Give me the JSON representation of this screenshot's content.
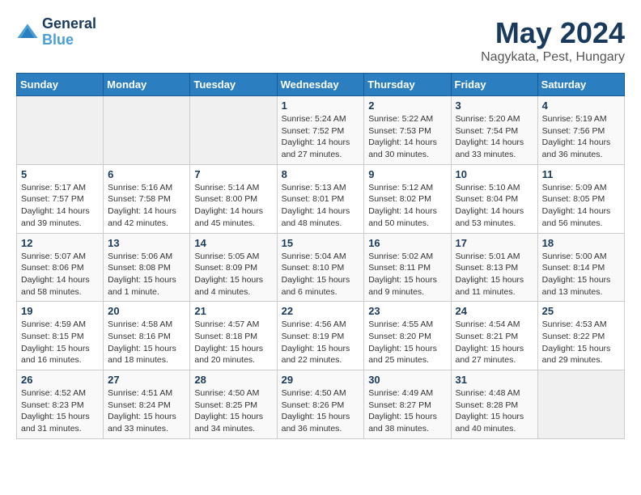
{
  "header": {
    "logo_line1": "General",
    "logo_line2": "Blue",
    "main_title": "May 2024",
    "subtitle": "Nagykata, Pest, Hungary"
  },
  "calendar": {
    "days_of_week": [
      "Sunday",
      "Monday",
      "Tuesday",
      "Wednesday",
      "Thursday",
      "Friday",
      "Saturday"
    ],
    "weeks": [
      [
        {
          "day": "",
          "info": ""
        },
        {
          "day": "",
          "info": ""
        },
        {
          "day": "",
          "info": ""
        },
        {
          "day": "1",
          "info": "Sunrise: 5:24 AM\nSunset: 7:52 PM\nDaylight: 14 hours\nand 27 minutes."
        },
        {
          "day": "2",
          "info": "Sunrise: 5:22 AM\nSunset: 7:53 PM\nDaylight: 14 hours\nand 30 minutes."
        },
        {
          "day": "3",
          "info": "Sunrise: 5:20 AM\nSunset: 7:54 PM\nDaylight: 14 hours\nand 33 minutes."
        },
        {
          "day": "4",
          "info": "Sunrise: 5:19 AM\nSunset: 7:56 PM\nDaylight: 14 hours\nand 36 minutes."
        }
      ],
      [
        {
          "day": "5",
          "info": "Sunrise: 5:17 AM\nSunset: 7:57 PM\nDaylight: 14 hours\nand 39 minutes."
        },
        {
          "day": "6",
          "info": "Sunrise: 5:16 AM\nSunset: 7:58 PM\nDaylight: 14 hours\nand 42 minutes."
        },
        {
          "day": "7",
          "info": "Sunrise: 5:14 AM\nSunset: 8:00 PM\nDaylight: 14 hours\nand 45 minutes."
        },
        {
          "day": "8",
          "info": "Sunrise: 5:13 AM\nSunset: 8:01 PM\nDaylight: 14 hours\nand 48 minutes."
        },
        {
          "day": "9",
          "info": "Sunrise: 5:12 AM\nSunset: 8:02 PM\nDaylight: 14 hours\nand 50 minutes."
        },
        {
          "day": "10",
          "info": "Sunrise: 5:10 AM\nSunset: 8:04 PM\nDaylight: 14 hours\nand 53 minutes."
        },
        {
          "day": "11",
          "info": "Sunrise: 5:09 AM\nSunset: 8:05 PM\nDaylight: 14 hours\nand 56 minutes."
        }
      ],
      [
        {
          "day": "12",
          "info": "Sunrise: 5:07 AM\nSunset: 8:06 PM\nDaylight: 14 hours\nand 58 minutes."
        },
        {
          "day": "13",
          "info": "Sunrise: 5:06 AM\nSunset: 8:08 PM\nDaylight: 15 hours\nand 1 minute."
        },
        {
          "day": "14",
          "info": "Sunrise: 5:05 AM\nSunset: 8:09 PM\nDaylight: 15 hours\nand 4 minutes."
        },
        {
          "day": "15",
          "info": "Sunrise: 5:04 AM\nSunset: 8:10 PM\nDaylight: 15 hours\nand 6 minutes."
        },
        {
          "day": "16",
          "info": "Sunrise: 5:02 AM\nSunset: 8:11 PM\nDaylight: 15 hours\nand 9 minutes."
        },
        {
          "day": "17",
          "info": "Sunrise: 5:01 AM\nSunset: 8:13 PM\nDaylight: 15 hours\nand 11 minutes."
        },
        {
          "day": "18",
          "info": "Sunrise: 5:00 AM\nSunset: 8:14 PM\nDaylight: 15 hours\nand 13 minutes."
        }
      ],
      [
        {
          "day": "19",
          "info": "Sunrise: 4:59 AM\nSunset: 8:15 PM\nDaylight: 15 hours\nand 16 minutes."
        },
        {
          "day": "20",
          "info": "Sunrise: 4:58 AM\nSunset: 8:16 PM\nDaylight: 15 hours\nand 18 minutes."
        },
        {
          "day": "21",
          "info": "Sunrise: 4:57 AM\nSunset: 8:18 PM\nDaylight: 15 hours\nand 20 minutes."
        },
        {
          "day": "22",
          "info": "Sunrise: 4:56 AM\nSunset: 8:19 PM\nDaylight: 15 hours\nand 22 minutes."
        },
        {
          "day": "23",
          "info": "Sunrise: 4:55 AM\nSunset: 8:20 PM\nDaylight: 15 hours\nand 25 minutes."
        },
        {
          "day": "24",
          "info": "Sunrise: 4:54 AM\nSunset: 8:21 PM\nDaylight: 15 hours\nand 27 minutes."
        },
        {
          "day": "25",
          "info": "Sunrise: 4:53 AM\nSunset: 8:22 PM\nDaylight: 15 hours\nand 29 minutes."
        }
      ],
      [
        {
          "day": "26",
          "info": "Sunrise: 4:52 AM\nSunset: 8:23 PM\nDaylight: 15 hours\nand 31 minutes."
        },
        {
          "day": "27",
          "info": "Sunrise: 4:51 AM\nSunset: 8:24 PM\nDaylight: 15 hours\nand 33 minutes."
        },
        {
          "day": "28",
          "info": "Sunrise: 4:50 AM\nSunset: 8:25 PM\nDaylight: 15 hours\nand 34 minutes."
        },
        {
          "day": "29",
          "info": "Sunrise: 4:50 AM\nSunset: 8:26 PM\nDaylight: 15 hours\nand 36 minutes."
        },
        {
          "day": "30",
          "info": "Sunrise: 4:49 AM\nSunset: 8:27 PM\nDaylight: 15 hours\nand 38 minutes."
        },
        {
          "day": "31",
          "info": "Sunrise: 4:48 AM\nSunset: 8:28 PM\nDaylight: 15 hours\nand 40 minutes."
        },
        {
          "day": "",
          "info": ""
        }
      ]
    ]
  }
}
